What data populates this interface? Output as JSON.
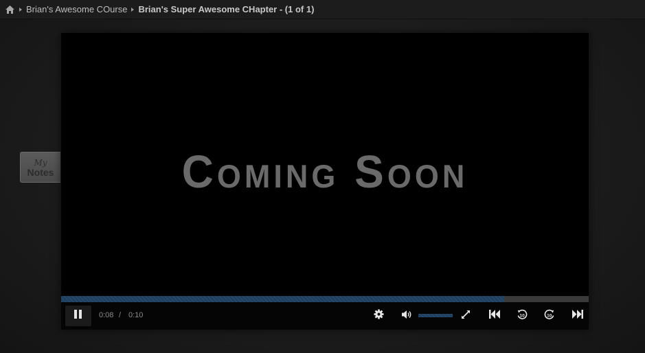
{
  "breadcrumb": {
    "home_icon": "home-icon",
    "course": "Brian's Awesome COurse",
    "chapter": "Brian's Super Awesome CHapter - (1 of 1)"
  },
  "notes_tab": {
    "my": "My",
    "label": "Notes"
  },
  "video": {
    "overlay_text": "Coming Soon",
    "current_time": "0:08",
    "separator": "/",
    "duration": "0:10",
    "progress_fraction": 0.84,
    "volume_fraction": 1.0,
    "accent_color": "#26496b",
    "icons": [
      "pause-icon",
      "settings-gear-icon",
      "volume-icon",
      "fullscreen-icon",
      "skip-to-start-icon",
      "rewind-10-icon",
      "forward-10-icon",
      "skip-to-end-icon"
    ]
  }
}
